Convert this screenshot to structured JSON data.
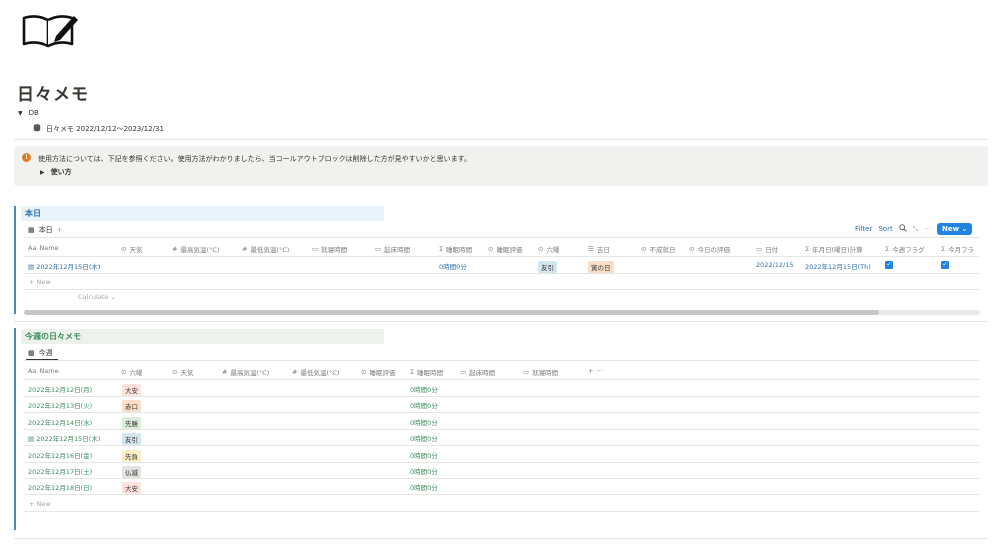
{
  "page": {
    "title": "日々メモ",
    "toggle_label": "DB",
    "db_link": "日々メモ 2022/12/12〜2023/12/31"
  },
  "callout": {
    "text": "使用方法については、下記を参照ください。使用方法がわかりましたら、当コールアウトブロックは削除した方が見やすいかと思います。",
    "toggle_label": "使い方",
    "icon": "info-icon"
  },
  "today": {
    "heading": "本日",
    "view_tab": "本日",
    "toolbar": {
      "filter": "Filter",
      "sort": "Sort",
      "new": "New"
    },
    "columns": [
      "Name",
      "天気",
      "最高気温(°C)",
      "最低気温(°C)",
      "就寝時間",
      "起床時間",
      "睡眠時間",
      "睡眠評価",
      "六曜",
      "吉日",
      "不成就日",
      "今日の評価",
      "日付",
      "年月日(曜日)計算",
      "今週フラグ",
      "今月フラ"
    ],
    "row": {
      "name": "2022年12月15日(木)",
      "sleep": "0時間0分",
      "rokuyo": "友引",
      "kichijitsu": "寅の日",
      "date": "2022/12/15",
      "calc": "2022年12月15日(Th)"
    },
    "new_label": "New",
    "calculate_label": "Calculate"
  },
  "week": {
    "heading": "今週の日々メモ",
    "view_tab": "今週",
    "columns": [
      "Name",
      "六曜",
      "天気",
      "最高気温(°C)",
      "最低気温(°C)",
      "睡眠評価",
      "睡眠時間",
      "起床時間",
      "就寝時間"
    ],
    "rows": [
      {
        "name": "2022年12月12日(月)",
        "rokuyo": "大安",
        "sleep": "0時間0分",
        "tag": "red"
      },
      {
        "name": "2022年12月13日(火)",
        "rokuyo": "赤口",
        "sleep": "0時間0分",
        "tag": "orange"
      },
      {
        "name": "2022年12月14日(水)",
        "rokuyo": "先勝",
        "sleep": "0時間0分",
        "tag": "green"
      },
      {
        "name": "2022年12月15日(木)",
        "rokuyo": "友引",
        "sleep": "0時間0分",
        "tag": "blue"
      },
      {
        "name": "2022年12月16日(金)",
        "rokuyo": "先負",
        "sleep": "0時間0分",
        "tag": "yellow"
      },
      {
        "name": "2022年12月17日(土)",
        "rokuyo": "仏滅",
        "sleep": "0時間0分",
        "tag": "gray"
      },
      {
        "name": "2022年12月18日(日)",
        "rokuyo": "大安",
        "sleep": "0時間0分",
        "tag": "red"
      }
    ],
    "new_label": "New"
  },
  "colors": {
    "accent": "#2383e2",
    "link": "#2e6fa8",
    "green_text": "#3d8a5f",
    "section_bar": "#4b8bab"
  }
}
